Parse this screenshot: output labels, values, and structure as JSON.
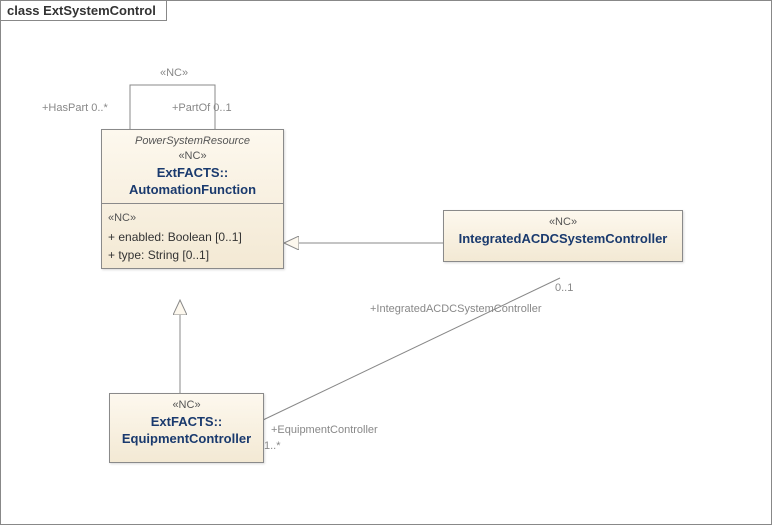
{
  "frame": {
    "title": "class ExtSystemControl"
  },
  "classes": {
    "automationFunction": {
      "package": "PowerSystemResource",
      "stereotype": "«NC»",
      "namePrefix": "ExtFACTS::",
      "name": "AutomationFunction",
      "attrStereotype": "«NC»",
      "attrs": [
        "+   enabled: Boolean [0..1]",
        "+   type: String [0..1]"
      ]
    },
    "integratedController": {
      "stereotype": "«NC»",
      "name": "IntegratedACDCSystemController"
    },
    "equipmentController": {
      "stereotype": "«NC»",
      "namePrefix": "ExtFACTS::",
      "name": "EquipmentController"
    }
  },
  "labels": {
    "selfAssocStereo": "«NC»",
    "hasPart": "+HasPart 0..*",
    "partOf": "+PartOf 0..1",
    "equipmentControllerRole": "+EquipmentController",
    "equipmentControllerMult": "1..*",
    "integratedControllerRole": "+IntegratedACDCSystemController",
    "integratedControllerMult": "0..1"
  },
  "chart_data": {
    "type": "uml_class_diagram",
    "title": "class ExtSystemControl",
    "classes": [
      {
        "id": "AutomationFunction",
        "qualifiedName": "ExtFACTS::AutomationFunction",
        "stereotype": "NC",
        "package": "PowerSystemResource",
        "attributes": [
          {
            "name": "enabled",
            "type": "Boolean",
            "multiplicity": "0..1",
            "visibility": "+",
            "stereotype": "NC"
          },
          {
            "name": "type",
            "type": "String",
            "multiplicity": "0..1",
            "visibility": "+",
            "stereotype": "NC"
          }
        ]
      },
      {
        "id": "IntegratedACDCSystemController",
        "stereotype": "NC",
        "attributes": []
      },
      {
        "id": "EquipmentController",
        "qualifiedName": "ExtFACTS::EquipmentController",
        "stereotype": "NC",
        "attributes": []
      }
    ],
    "relationships": [
      {
        "kind": "generalization",
        "child": "IntegratedACDCSystemController",
        "parent": "AutomationFunction"
      },
      {
        "kind": "generalization",
        "child": "EquipmentController",
        "parent": "AutomationFunction"
      },
      {
        "kind": "association",
        "stereotype": "NC",
        "endA": {
          "class": "AutomationFunction",
          "role": "HasPart",
          "multiplicity": "0..*"
        },
        "endB": {
          "class": "AutomationFunction",
          "role": "PartOf",
          "multiplicity": "0..1"
        },
        "self": true
      },
      {
        "kind": "association",
        "endA": {
          "class": "EquipmentController",
          "role": "EquipmentController",
          "multiplicity": "1..*"
        },
        "endB": {
          "class": "IntegratedACDCSystemController",
          "role": "IntegratedACDCSystemController",
          "multiplicity": "0..1"
        }
      }
    ]
  }
}
